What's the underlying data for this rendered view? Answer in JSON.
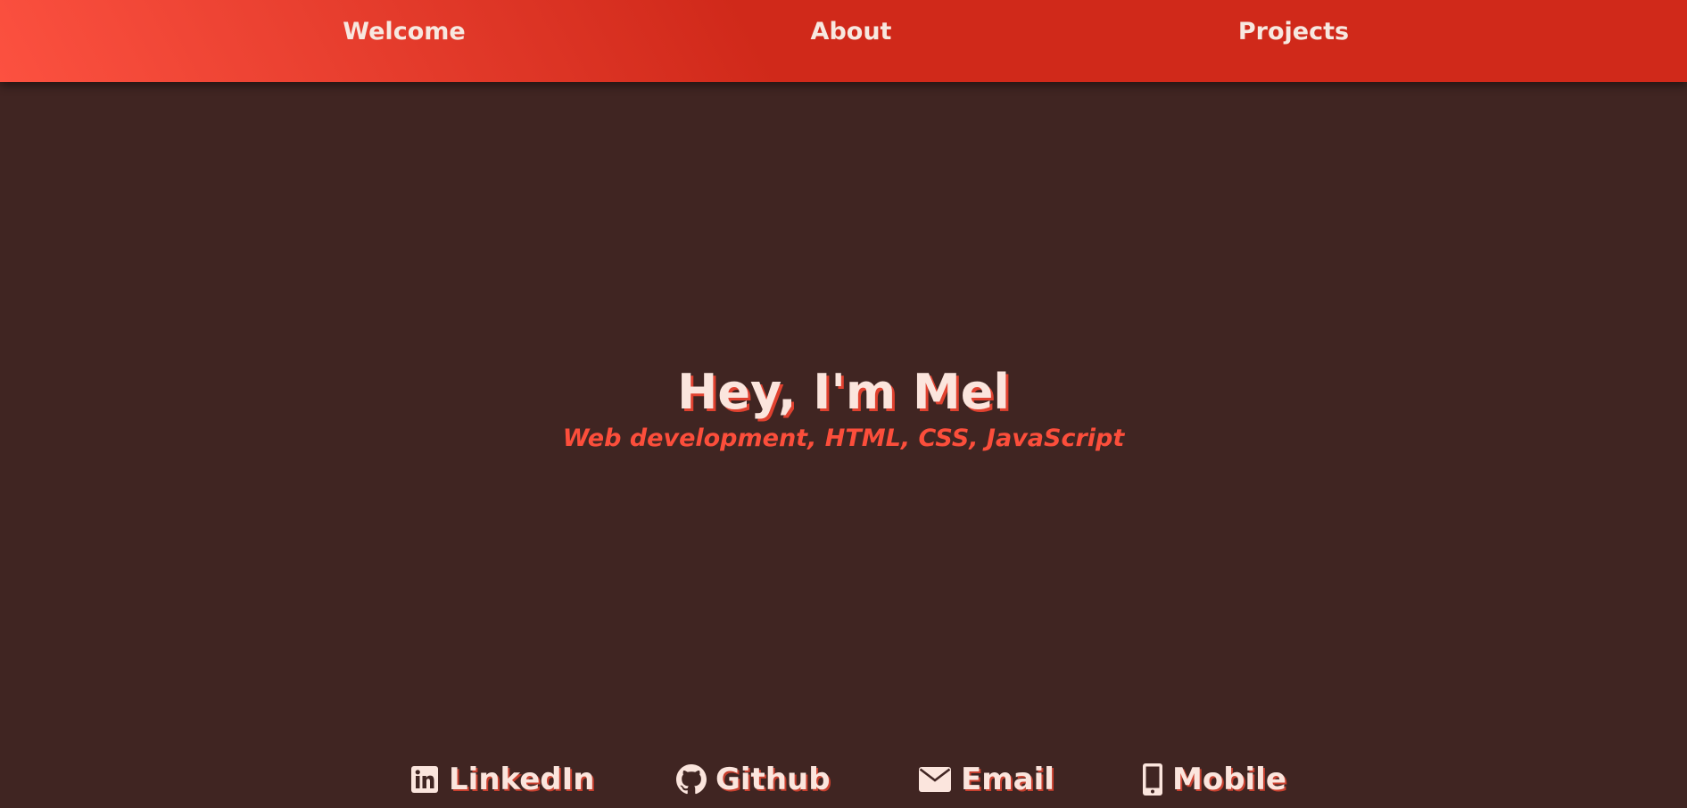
{
  "nav": {
    "items": [
      {
        "label": "Welcome"
      },
      {
        "label": "About"
      },
      {
        "label": "Projects"
      }
    ]
  },
  "hero": {
    "title": "Hey, I'm Mel",
    "subtitle": "Web development, HTML, CSS, JavaScript"
  },
  "contacts": [
    {
      "label": "LinkedIn",
      "icon": "linkedin-icon"
    },
    {
      "label": "Github",
      "icon": "github-icon"
    },
    {
      "label": "Email",
      "icon": "envelope-icon"
    },
    {
      "label": "Mobile",
      "icon": "mobile-phone-icon"
    }
  ],
  "colors": {
    "background": "#402522",
    "nav_gradient_start": "#fc5140",
    "nav_gradient_end": "#d0291a",
    "text_light": "#fbe5dd",
    "accent": "#fc4e3b"
  }
}
